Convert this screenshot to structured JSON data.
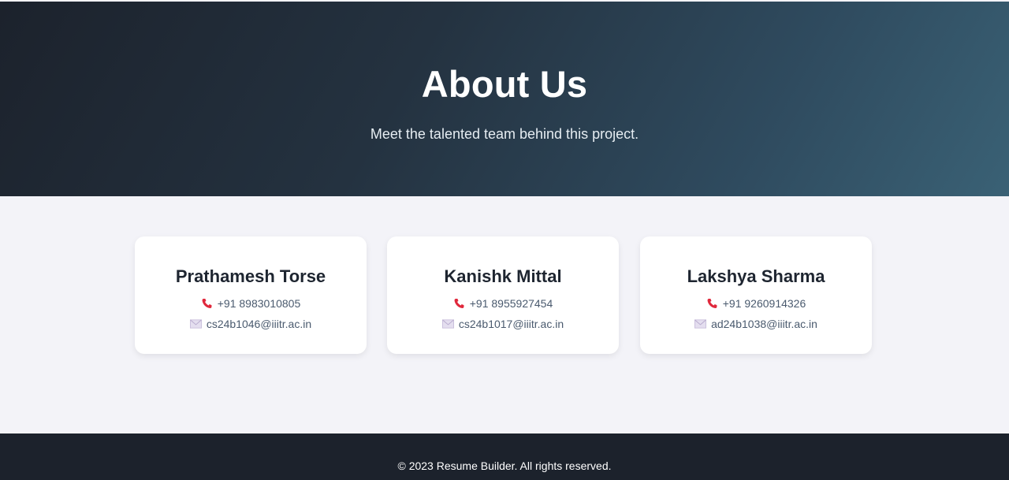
{
  "hero": {
    "title": "About Us",
    "subtitle": "Meet the talented team behind this project."
  },
  "members": [
    {
      "name": "Prathamesh Torse",
      "phone": "+91 8983010805",
      "email": "cs24b1046@iiitr.ac.in"
    },
    {
      "name": "Kanishk Mittal",
      "phone": "+91 8955927454",
      "email": "cs24b1017@iiitr.ac.in"
    },
    {
      "name": "Lakshya Sharma",
      "phone": "+91 9260914326",
      "email": "ad24b1038@iiitr.ac.in"
    }
  ],
  "icons": {
    "phone": "phone-icon",
    "email": "envelope-icon"
  },
  "colors": {
    "phone_icon": "#e0283c",
    "email_icon": "#c9bfdc",
    "footer_bg": "#1c222c"
  },
  "footer": {
    "text": "© 2023 Resume Builder. All rights reserved."
  }
}
